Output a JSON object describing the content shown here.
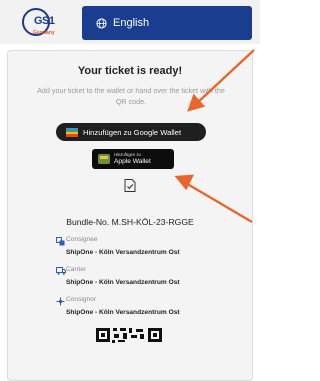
{
  "header": {
    "logo_text": "GS1",
    "logo_sub": "Germany",
    "language": "English"
  },
  "ticket": {
    "title": "Your ticket is ready!",
    "hint": "Add your ticket to the wallet or hand over the ticket with the QR code.",
    "google_wallet_label": "Hinzufügen zu Google Wallet",
    "apple_wallet_small": "Hinzufügen zu",
    "apple_wallet_big": "Apple Wallet",
    "bundle": "Bundle-No. M.SH-KÖL-23-RGGE",
    "rows": [
      {
        "label": "Consignee",
        "value": "ShipOne - Köln Versandzentrum Ost"
      },
      {
        "label": "Carrier",
        "value": "ShipOne - Köln Versandzentrum Ost"
      },
      {
        "label": "Consignor",
        "value": "ShipOne - Köln Versandzentrum Ost"
      }
    ]
  },
  "colors": {
    "brand_blue": "#1a3d8f",
    "accent_arrow": "#e8662a"
  }
}
